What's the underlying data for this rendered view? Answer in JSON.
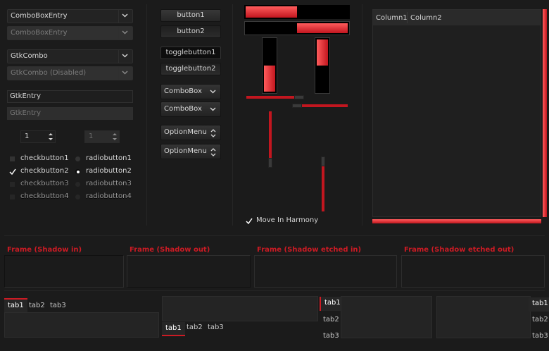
{
  "left": {
    "combo_entry": "ComboBoxEntry",
    "combo_entry_disabled": "ComboBoxEntry",
    "gtk_combo": "GtkCombo",
    "gtk_combo_disabled": "GtkCombo (Disabled)",
    "entry": "GtkEntry",
    "entry_disabled": "GtkEntry",
    "spin1": "1",
    "spin2": "1",
    "checks": [
      "checkbutton1",
      "checkbutton2",
      "checkbutton3",
      "checkbutton4"
    ],
    "radios": [
      "radiobutton1",
      "radiobutton2",
      "radiobutton3",
      "radiobutton4"
    ]
  },
  "buttons": {
    "button1": "button1",
    "button2": "button2",
    "toggle1": "togglebutton1",
    "toggle2": "togglebutton2",
    "combobox1": "ComboBox",
    "combobox2": "ComboBox",
    "option1": "OptionMenu",
    "option2": "OptionMenu"
  },
  "progress": {
    "h1_fraction": 0.5,
    "h2_fraction": 0.5,
    "v1_fraction": 0.5,
    "v2_fraction": 0.5,
    "harmony_label": "Move In Harmony"
  },
  "tree": {
    "columns": [
      "Column1",
      "Column2"
    ]
  },
  "frames": [
    "Frame (Shadow in)",
    "Frame (Shadow out)",
    "Frame (Shadow etched in)",
    "Frame (Shadow etched out)"
  ],
  "tabs": {
    "top": [
      "tab1",
      "tab2",
      "tab3"
    ],
    "bottom": [
      "tab1",
      "tab2",
      "tab3"
    ],
    "left": [
      "tab1",
      "tab2",
      "tab3"
    ],
    "right": [
      "tab1",
      "tab2",
      "tab3"
    ]
  },
  "colors": {
    "accent": "#cc1b24",
    "background": "#1b1b1b"
  }
}
